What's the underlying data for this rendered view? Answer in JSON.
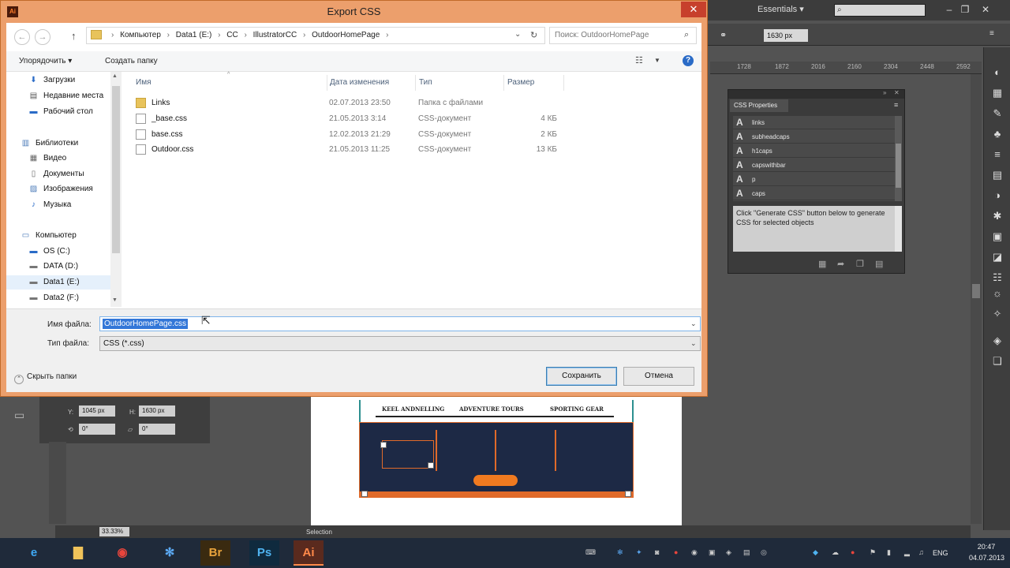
{
  "dialog": {
    "title": "Export CSS",
    "close_glyph": "✕",
    "app_icon_text": "Ai",
    "nav": {
      "back_glyph": "←",
      "forward_glyph": "→",
      "up_glyph": "↑",
      "breadcrumb": [
        "Компьютер",
        "Data1 (E:)",
        "CC",
        "IllustratorCC",
        "OutdoorHomePage"
      ],
      "breadcrumb_sep": "›",
      "refresh_glyph": "↻",
      "search_placeholder": "Поиск: OutdoorHomePage",
      "search_glyph": "⌕"
    },
    "commands": {
      "organize": "Упорядочить ▾",
      "new_folder": "Создать папку",
      "help_glyph": "?"
    },
    "nav_pane": [
      {
        "label": "Загрузки",
        "icon": "downloads-icon",
        "glyph": "⬇"
      },
      {
        "label": "Недавние места",
        "icon": "recent-places-icon",
        "glyph": "▤"
      },
      {
        "label": "Рабочий стол",
        "icon": "desktop-icon",
        "glyph": "▬"
      },
      {
        "label": "Библиотеки",
        "icon": "libraries-icon",
        "glyph": "▥"
      },
      {
        "label": "Видео",
        "icon": "video-icon",
        "glyph": "▦"
      },
      {
        "label": "Документы",
        "icon": "documents-icon",
        "glyph": "▯"
      },
      {
        "label": "Изображения",
        "icon": "pictures-icon",
        "glyph": "▨"
      },
      {
        "label": "Музыка",
        "icon": "music-icon",
        "glyph": "♪"
      },
      {
        "label": "Компьютер",
        "icon": "computer-icon",
        "glyph": "▭"
      },
      {
        "label": "OS (C:)",
        "icon": "drive-icon",
        "glyph": "▬"
      },
      {
        "label": "DATA (D:)",
        "icon": "drive-icon",
        "glyph": "▬"
      },
      {
        "label": "Data1 (E:)",
        "icon": "drive-icon",
        "glyph": "▬"
      },
      {
        "label": "Data2 (F:)",
        "icon": "drive-icon",
        "glyph": "▬"
      }
    ],
    "columns": [
      "Имя",
      "Дата изменения",
      "Тип",
      "Размер"
    ],
    "files": [
      {
        "name": "Links",
        "date": "02.07.2013 23:50",
        "type": "Папка с файлами",
        "size": "",
        "icon": "folder-icon"
      },
      {
        "name": "_base.css",
        "date": "21.05.2013 3:14",
        "type": "CSS-документ",
        "size": "4 КБ",
        "icon": "css-file-icon"
      },
      {
        "name": "base.css",
        "date": "12.02.2013 21:29",
        "type": "CSS-документ",
        "size": "2 КБ",
        "icon": "css-file-icon"
      },
      {
        "name": "Outdoor.css",
        "date": "21.05.2013 11:25",
        "type": "CSS-документ",
        "size": "13 КБ",
        "icon": "css-file-icon"
      }
    ],
    "form": {
      "filename_label": "Имя файла:",
      "filename_value": "OutdoorHomePage.css",
      "filetype_label": "Тип файла:",
      "filetype_value": "CSS (*.css)",
      "dropdown_glyph": "⌄",
      "hide_folders": "Скрыть папки",
      "save": "Сохранить",
      "cancel": "Отмена"
    }
  },
  "illustrator": {
    "workspace": "Essentials ▾",
    "width_value": "1630 px",
    "ruler_ticks": [
      "1728",
      "1872",
      "2016",
      "2160",
      "2304",
      "2448",
      "2592"
    ],
    "css_panel": {
      "tab": "CSS Properties",
      "styles": [
        "links",
        "subheadcaps",
        "h1caps",
        "capswithbar",
        "p",
        "caps"
      ],
      "description": "Click \"Generate CSS\" button below to generate CSS for selected objects"
    },
    "transform": {
      "y_label": "Y:",
      "y_value": "1045 px",
      "h_label": "H:",
      "h_value": "1630 px",
      "angle1": "0°",
      "angle2": "0°"
    },
    "artboard_heads": [
      "KEEL ANDNELLING",
      "ADVENTURE TOURS",
      "SPORTING GEAR"
    ],
    "status": {
      "zoom": "33.33%",
      "tool": "Selection"
    }
  },
  "taskbar": {
    "apps": [
      {
        "name": "Internet Explorer",
        "glyph": "e",
        "color": "#3fa9f5"
      },
      {
        "name": "File Explorer",
        "glyph": "▇",
        "color": "#f0c35a"
      },
      {
        "name": "Chrome",
        "glyph": "◉",
        "color": "#e8453c"
      },
      {
        "name": "Snowflake",
        "glyph": "✻",
        "color": "#5aa7f0"
      },
      {
        "name": "Bridge",
        "glyph": "Br",
        "color": "#e8a33c"
      },
      {
        "name": "Photoshop",
        "glyph": "Ps",
        "color": "#4fb3f0"
      },
      {
        "name": "Illustrator",
        "glyph": "Ai",
        "color": "#ff8a4a"
      }
    ],
    "lang": "ENG",
    "time": "20:47",
    "date": "04.07.2013"
  }
}
